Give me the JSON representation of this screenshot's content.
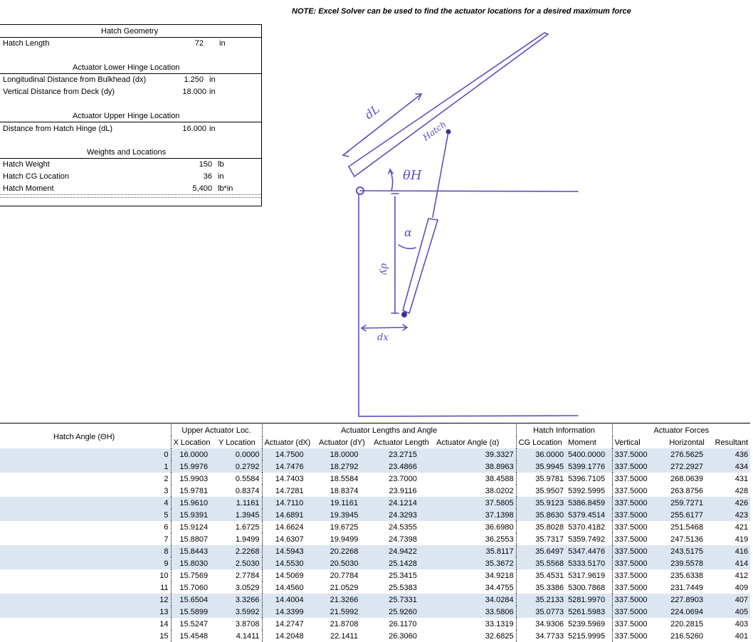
{
  "note": "NOTE: Excel Solver can be used to find the actuator locations for a desired maximum force",
  "geometry": {
    "title": "Hatch Geometry",
    "hatch_length_label": "Hatch Length",
    "hatch_length_value": "72",
    "hatch_length_unit": "in",
    "lower_title": "Actuator Lower Hinge Location",
    "dx_label": "Longitudinal Distance from Bulkhead (dx)",
    "dx_value": "1.250",
    "dx_unit": "in",
    "dy_label": "Vertical Distance from Deck (dy)",
    "dy_value": "18.000",
    "dy_unit": "in",
    "upper_title": "Actuator Upper Hinge Location",
    "dl_label": "Distance from Hatch Hinge (dL)",
    "dl_value": "16.000",
    "dl_unit": "in",
    "weights_title": "Weights and Locations",
    "weight_label": "Hatch Weight",
    "weight_value": "150",
    "weight_unit": "lb",
    "cg_label": "Hatch CG Location",
    "cg_value": "36",
    "cg_unit": "in",
    "moment_label": "Hatch Moment",
    "moment_value": "5,400",
    "moment_unit": "lb*in"
  },
  "sketch": {
    "dL": "dL",
    "hatch": "Hatch",
    "theta": "θH",
    "alpha": "α",
    "dy": "dy",
    "dx": "dx"
  },
  "table": {
    "angle_header": "Hatch Angle (ΘH)",
    "groups": [
      "Upper Actuator Loc.",
      "Actuator Lengths and Angle",
      "Hatch Information",
      "Actuator Forces"
    ],
    "columns": [
      "X Location",
      "Y Location",
      "Actuator (dX)",
      "Actuator (dY)",
      "Actuator Length",
      "Actuator Angle (α)",
      "CG Location",
      "Moment",
      "Vertical",
      "Horizontal",
      "Resultant"
    ],
    "rows": [
      [
        "0",
        "16.0000",
        "0.0000",
        "14.7500",
        "18.0000",
        "23.2715",
        "39.3327",
        "36.0000",
        "5400.0000",
        "337.5000",
        "276.5625",
        "436"
      ],
      [
        "1",
        "15.9976",
        "0.2792",
        "14.7476",
        "18.2792",
        "23.4866",
        "38.8963",
        "35.9945",
        "5399.1776",
        "337.5000",
        "272.2927",
        "434"
      ],
      [
        "2",
        "15.9903",
        "0.5584",
        "14.7403",
        "18.5584",
        "23.7000",
        "38.4588",
        "35.9781",
        "5396.7105",
        "337.5000",
        "268.0639",
        "431"
      ],
      [
        "3",
        "15.9781",
        "0.8374",
        "14.7281",
        "18.8374",
        "23.9116",
        "38.0202",
        "35.9507",
        "5392.5995",
        "337.5000",
        "263.8756",
        "428"
      ],
      [
        "4",
        "15.9610",
        "1.1161",
        "14.7110",
        "19.1161",
        "24.1214",
        "37.5805",
        "35.9123",
        "5386.8459",
        "337.5000",
        "259.7271",
        "426"
      ],
      [
        "5",
        "15.9391",
        "1.3945",
        "14.6891",
        "19.3945",
        "24.3293",
        "37.1398",
        "35.8630",
        "5379.4514",
        "337.5000",
        "255.6177",
        "423"
      ],
      [
        "6",
        "15.9124",
        "1.6725",
        "14.6624",
        "19.6725",
        "24.5355",
        "36.6980",
        "35.8028",
        "5370.4182",
        "337.5000",
        "251.5468",
        "421"
      ],
      [
        "7",
        "15.8807",
        "1.9499",
        "14.6307",
        "19.9499",
        "24.7398",
        "36.2553",
        "35.7317",
        "5359.7492",
        "337.5000",
        "247.5136",
        "419"
      ],
      [
        "8",
        "15.8443",
        "2.2268",
        "14.5943",
        "20.2268",
        "24.9422",
        "35.8117",
        "35.6497",
        "5347.4476",
        "337.5000",
        "243.5175",
        "416"
      ],
      [
        "9",
        "15.8030",
        "2.5030",
        "14.5530",
        "20.5030",
        "25.1428",
        "35.3672",
        "35.5568",
        "5333.5170",
        "337.5000",
        "239.5578",
        "414"
      ],
      [
        "10",
        "15.7569",
        "2.7784",
        "14.5069",
        "20.7784",
        "25.3415",
        "34.9218",
        "35.4531",
        "5317.9619",
        "337.5000",
        "235.6338",
        "412"
      ],
      [
        "11",
        "15.7060",
        "3.0529",
        "14.4560",
        "21.0529",
        "25.5383",
        "34.4755",
        "35.3386",
        "5300.7868",
        "337.5000",
        "231.7449",
        "409"
      ],
      [
        "12",
        "15.6504",
        "3.3266",
        "14.4004",
        "21.3266",
        "25.7331",
        "34.0284",
        "35.2133",
        "5281.9970",
        "337.5000",
        "227.8903",
        "407"
      ],
      [
        "13",
        "15.5899",
        "3.5992",
        "14.3399",
        "21.5992",
        "25.9260",
        "33.5806",
        "35.0773",
        "5261.5983",
        "337.5000",
        "224.0694",
        "405"
      ],
      [
        "14",
        "15.5247",
        "3.8708",
        "14.2747",
        "21.8708",
        "26.1170",
        "33.1319",
        "34.9306",
        "5239.5969",
        "337.5000",
        "220.2815",
        "403"
      ],
      [
        "15",
        "15.4548",
        "4.1411",
        "14.2048",
        "22.1411",
        "26.3060",
        "32.6825",
        "34.7733",
        "5215.9995",
        "337.5000",
        "216.5260",
        "401"
      ]
    ]
  }
}
